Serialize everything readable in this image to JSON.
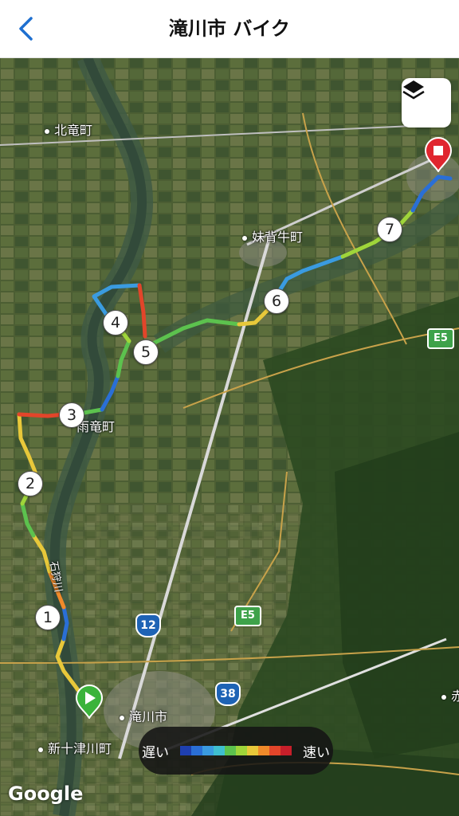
{
  "header": {
    "title": "滝川市 バイク",
    "back_icon": "chevron-left-icon"
  },
  "map": {
    "places": [
      {
        "key": "kitaryu",
        "label": "北竜町"
      },
      {
        "key": "moseushi",
        "label": "妹背牛町"
      },
      {
        "key": "uryu",
        "label": "雨竜町"
      },
      {
        "key": "takikawa",
        "label": "滝川市"
      },
      {
        "key": "shintotsukawa",
        "label": "新十津川町"
      },
      {
        "key": "ishikari",
        "label": "石狩川"
      },
      {
        "key": "edge",
        "label": "赤"
      }
    ],
    "waypoints": [
      "1",
      "2",
      "3",
      "4",
      "5",
      "6",
      "7"
    ],
    "road_shields": [
      {
        "key": "r12",
        "label": "12"
      },
      {
        "key": "r38",
        "label": "38"
      },
      {
        "key": "e5a",
        "label": "E5"
      },
      {
        "key": "e5b",
        "label": "E5"
      }
    ],
    "start_marker_icon": "play-icon",
    "end_marker_icon": "stop-icon"
  },
  "layers_button_icon": "layers-icon",
  "legend": {
    "slow": "遅い",
    "fast": "速い",
    "colors": [
      "#1e3fb0",
      "#2a6fd6",
      "#3a9be0",
      "#3fbfd0",
      "#5cc24e",
      "#9fd53a",
      "#e8c83a",
      "#f08a2a",
      "#e2452a",
      "#c61f2a"
    ]
  },
  "attribution": "Google"
}
